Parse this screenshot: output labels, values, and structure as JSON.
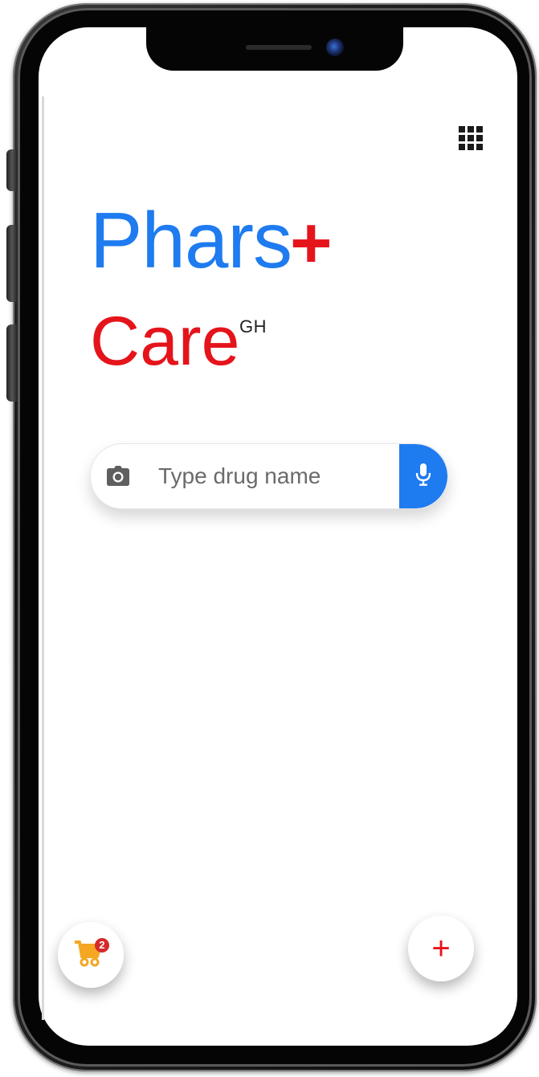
{
  "header": {
    "apps_icon": "apps-grid-icon"
  },
  "brand": {
    "title": "Phars",
    "title_accent": "+",
    "subtitle": "Care",
    "superscript": "GH"
  },
  "search": {
    "placeholder": "Type drug name",
    "value": "",
    "left_icon": "camera-icon",
    "right_icon": "microphone-icon"
  },
  "cart": {
    "icon": "cart-icon",
    "badge_count": "2"
  },
  "add_button": {
    "label": "+"
  },
  "colors": {
    "brand_blue": "#1e7bf0",
    "brand_red": "#e5141b",
    "cart_orange": "#f5a623",
    "badge_red": "#d32a2a"
  }
}
